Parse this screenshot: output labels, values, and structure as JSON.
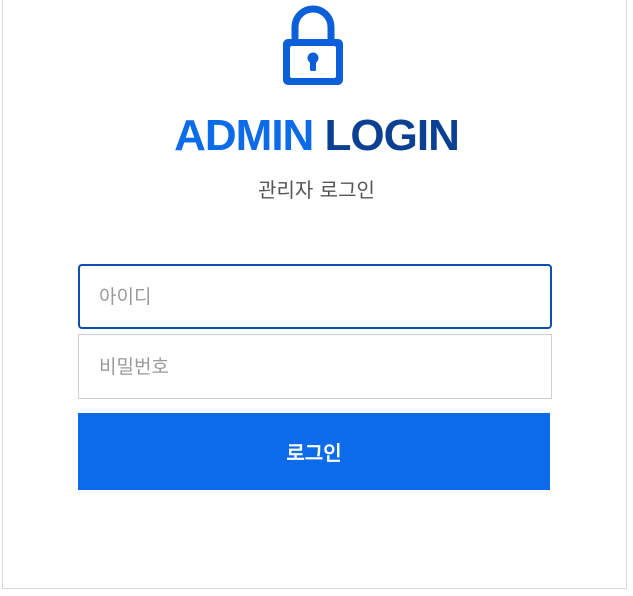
{
  "header": {
    "icon": "lock-icon",
    "title_part1": "ADMIN",
    "title_part2": "LOGIN",
    "subtitle": "관리자 로그인"
  },
  "form": {
    "userid_placeholder": "아이디",
    "userid_value": "",
    "password_placeholder": "비밀번호",
    "password_value": "",
    "submit_label": "로그인"
  },
  "colors": {
    "accent": "#0b6be8",
    "dark_blue": "#0b3f91",
    "focus_border": "#0b4fb0"
  }
}
